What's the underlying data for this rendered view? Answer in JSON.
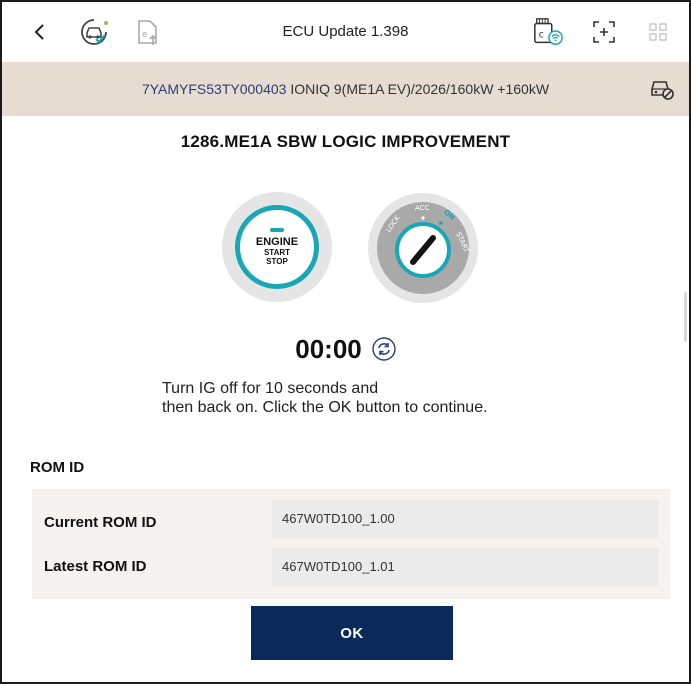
{
  "header": {
    "title": "ECU Update 1.398",
    "icons": [
      "chevron-left-icon",
      "vehicle-check-icon",
      "document-upload-icon",
      "vci-wifi-icon",
      "screen-capture-icon",
      "grid-menu-icon"
    ]
  },
  "vehicle": {
    "vin": "7YAMYFS53TY000403",
    "model": "IONIQ 9(ME1A EV)/2026/160kW +160kW",
    "icon": "vehicle-settings-icon"
  },
  "main": {
    "title": "1286.ME1A SBW LOGIC IMPROVEMENT",
    "engine_button": {
      "line1": "ENGINE",
      "line2": "START",
      "line3": "STOP"
    },
    "ignition_positions": [
      "LOCK",
      "ACC",
      "ON",
      "START"
    ],
    "timer": "00:00",
    "instruction_line1": "Turn IG off for 10 seconds and",
    "instruction_line2": "then back on. Click the OK button to continue."
  },
  "rom": {
    "section_title": "ROM ID",
    "rows": [
      {
        "label": "Current ROM ID",
        "value": "467W0TD100_1.00"
      },
      {
        "label": "Latest ROM ID",
        "value": "467W0TD100_1.01"
      }
    ]
  },
  "footer": {
    "ok_label": "OK"
  },
  "colors": {
    "accent_teal": "#19a7b5",
    "ok_button": "#0b2a5c",
    "vehicle_bar": "#e6dcd2",
    "vin_text": "#2a3f78"
  }
}
